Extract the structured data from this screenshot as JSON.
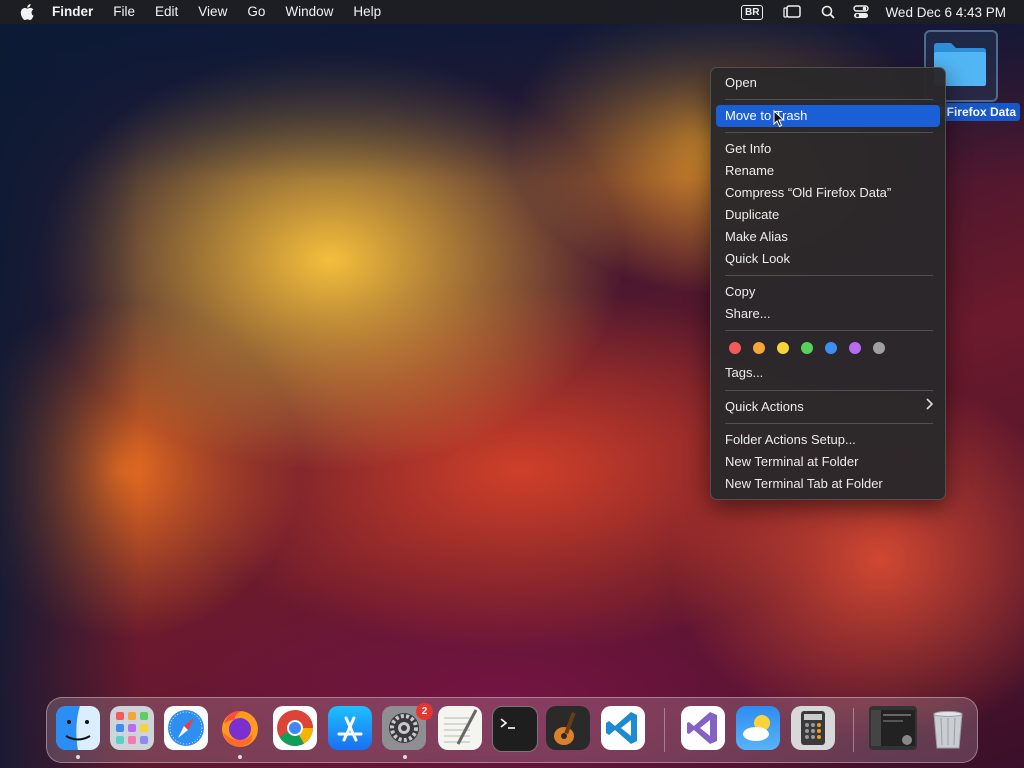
{
  "menubar": {
    "app_name": "Finder",
    "menus": [
      "File",
      "Edit",
      "View",
      "Go",
      "Window",
      "Help"
    ],
    "input_source": "BR",
    "clock": "Wed Dec 6  4:43 PM"
  },
  "desktop": {
    "selected_item_label": "Old Firefox Data"
  },
  "context_menu": {
    "highlighted": "Move to Trash",
    "items": {
      "open": "Open",
      "move_to_trash": "Move to Trash",
      "get_info": "Get Info",
      "rename": "Rename",
      "compress": "Compress “Old Firefox Data”",
      "duplicate": "Duplicate",
      "make_alias": "Make Alias",
      "quick_look": "Quick Look",
      "copy": "Copy",
      "share": "Share...",
      "tags": "Tags...",
      "quick_actions": "Quick Actions",
      "folder_actions_setup": "Folder Actions Setup...",
      "new_terminal_at_folder": "New Terminal at Folder",
      "new_terminal_tab_at_folder": "New Terminal Tab at Folder"
    },
    "tag_colors": [
      "#f25b57",
      "#f5a53a",
      "#f5d53a",
      "#5ad15a",
      "#3b8ff0",
      "#b86cf0",
      "#a0a0a0"
    ]
  },
  "dock": {
    "apps": [
      "finder-icon",
      "launchpad-icon",
      "safari-icon",
      "firefox-icon",
      "chrome-icon",
      "app-store-icon",
      "system-settings-icon",
      "textedit-icon",
      "terminal-icon",
      "garageband-icon",
      "vscode-icon",
      "visual-studio-icon",
      "weather-icon",
      "calculator-icon",
      "screenshot-thumbnail-icon",
      "trash-icon"
    ],
    "settings_badge": "2"
  },
  "colors": {
    "highlight": "#1a5fd6",
    "menu_background": "#2a282a"
  }
}
